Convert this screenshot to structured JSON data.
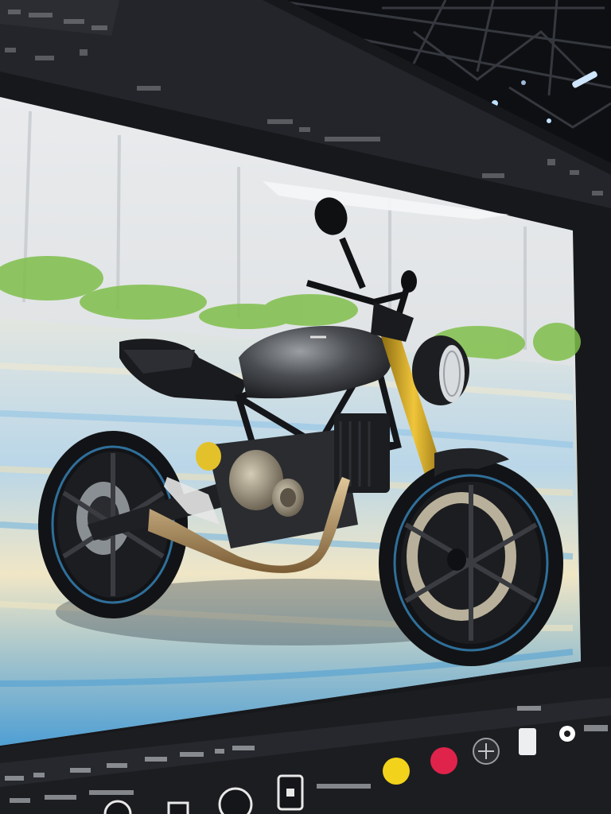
{
  "scene": {
    "subject": "motorcycle-on-display-screen",
    "colors": {
      "ceiling": "#15161a",
      "screen_bezel": "#1b1c20",
      "sky_wall": "#e6e8ea",
      "track_blue": "#5aa6d6",
      "track_cream": "#efe6c8",
      "foliage": "#7fbf4a",
      "bike_body": "#2a2c30",
      "fork_gold": "#c9a227",
      "engine_metal": "#9a8f7a",
      "exhaust": "#b89a6a",
      "button_yellow": "#f2d21b",
      "button_red": "#e0234b"
    }
  },
  "toolbar": {
    "icons": [
      "record-icon",
      "document-icon",
      "target-icon",
      "yellow-swatch-icon",
      "red-swatch-icon",
      "grid-icon",
      "square-icon",
      "circle-icon"
    ]
  }
}
